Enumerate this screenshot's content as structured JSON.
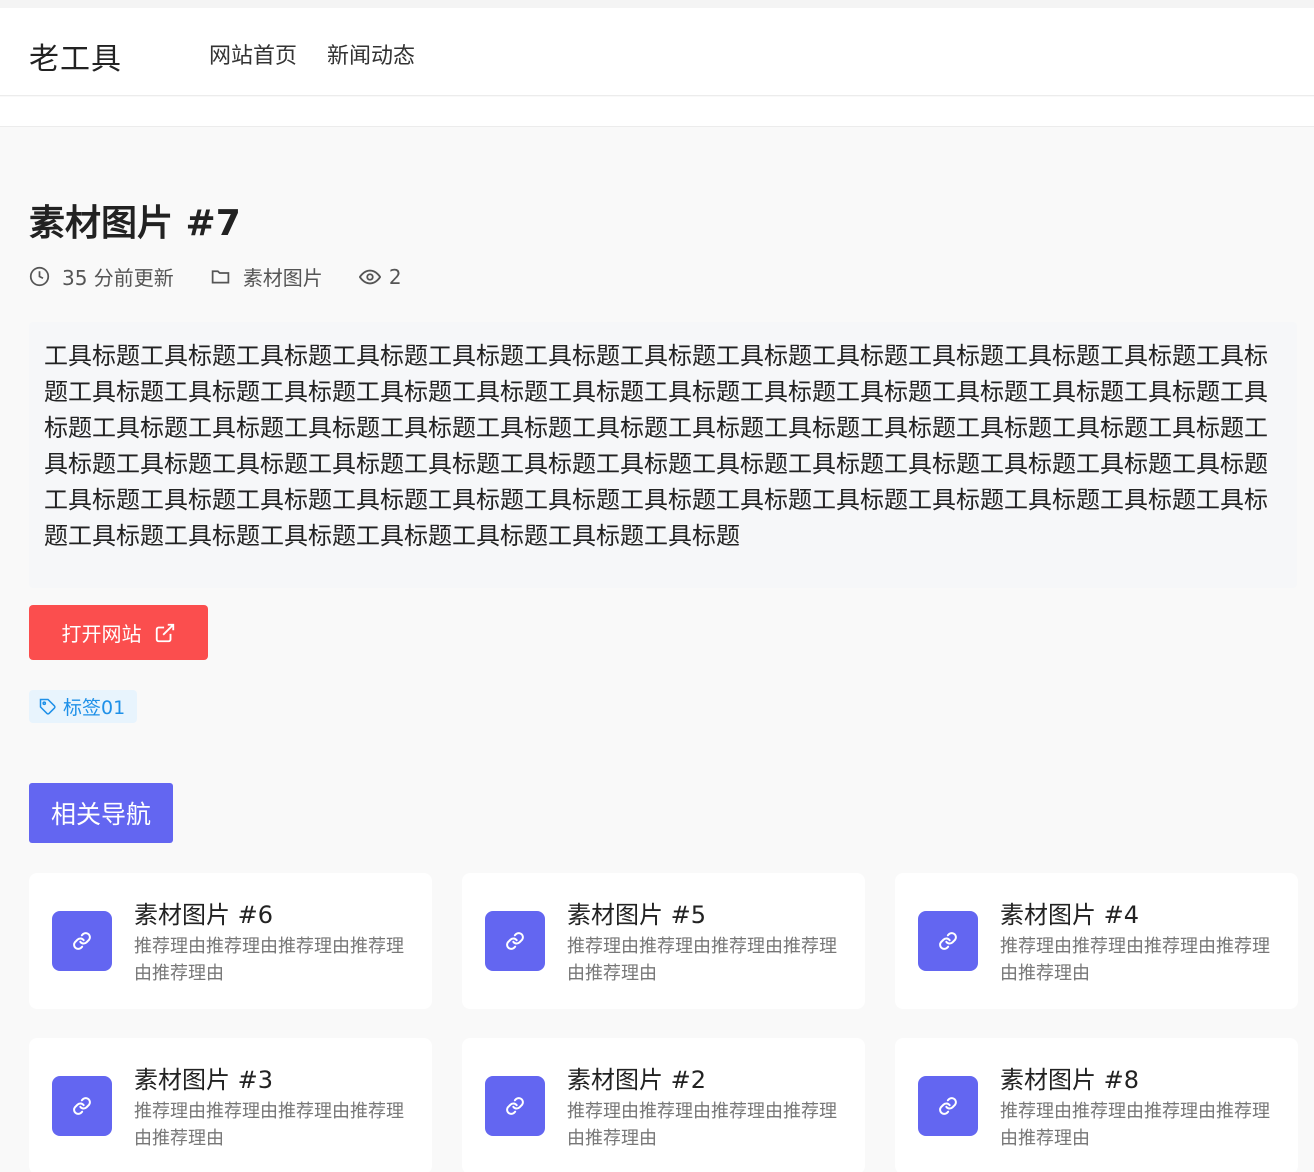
{
  "header": {
    "logo": "老工具",
    "nav": [
      {
        "label": "网站首页"
      },
      {
        "label": "新闻动态"
      }
    ]
  },
  "article": {
    "title": "素材图片 #7",
    "updated": "35 分前更新",
    "category": "素材图片",
    "views": "2",
    "description": "工具标题工具标题工具标题工具标题工具标题工具标题工具标题工具标题工具标题工具标题工具标题工具标题工具标题工具标题工具标题工具标题工具标题工具标题工具标题工具标题工具标题工具标题工具标题工具标题工具标题工具标题工具标题工具标题工具标题工具标题工具标题工具标题工具标题工具标题工具标题工具标题工具标题工具标题工具标题工具标题工具标题工具标题工具标题工具标题工具标题工具标题工具标题工具标题工具标题工具标题工具标题工具标题工具标题工具标题工具标题工具标题工具标题工具标题工具标题工具标题工具标题工具标题工具标题工具标题工具标题工具标题工具标题工具标题工具标题工具标题工具标题",
    "open_button": "打开网站",
    "tag": "标签01"
  },
  "related": {
    "heading": "相关导航",
    "cards": [
      {
        "title": "素材图片 #6",
        "desc": "推荐理由推荐理由推荐理由推荐理由推荐理由"
      },
      {
        "title": "素材图片 #5",
        "desc": "推荐理由推荐理由推荐理由推荐理由推荐理由"
      },
      {
        "title": "素材图片 #4",
        "desc": "推荐理由推荐理由推荐理由推荐理由推荐理由"
      },
      {
        "title": "素材图片 #3",
        "desc": "推荐理由推荐理由推荐理由推荐理由推荐理由"
      },
      {
        "title": "素材图片 #2",
        "desc": "推荐理由推荐理由推荐理由推荐理由推荐理由"
      },
      {
        "title": "素材图片 #8",
        "desc": "推荐理由推荐理由推荐理由推荐理由推荐理由"
      }
    ]
  },
  "colors": {
    "accent": "#6366f1",
    "open_button": "#fb4e4e",
    "tag_bg": "#e8f4fd",
    "tag_text": "#1e90e8"
  },
  "icons": {
    "clock": "clock-icon",
    "folder": "folder-icon",
    "eye": "eye-icon",
    "external": "external-link-icon",
    "tag": "tag-icon",
    "link": "link-icon"
  }
}
